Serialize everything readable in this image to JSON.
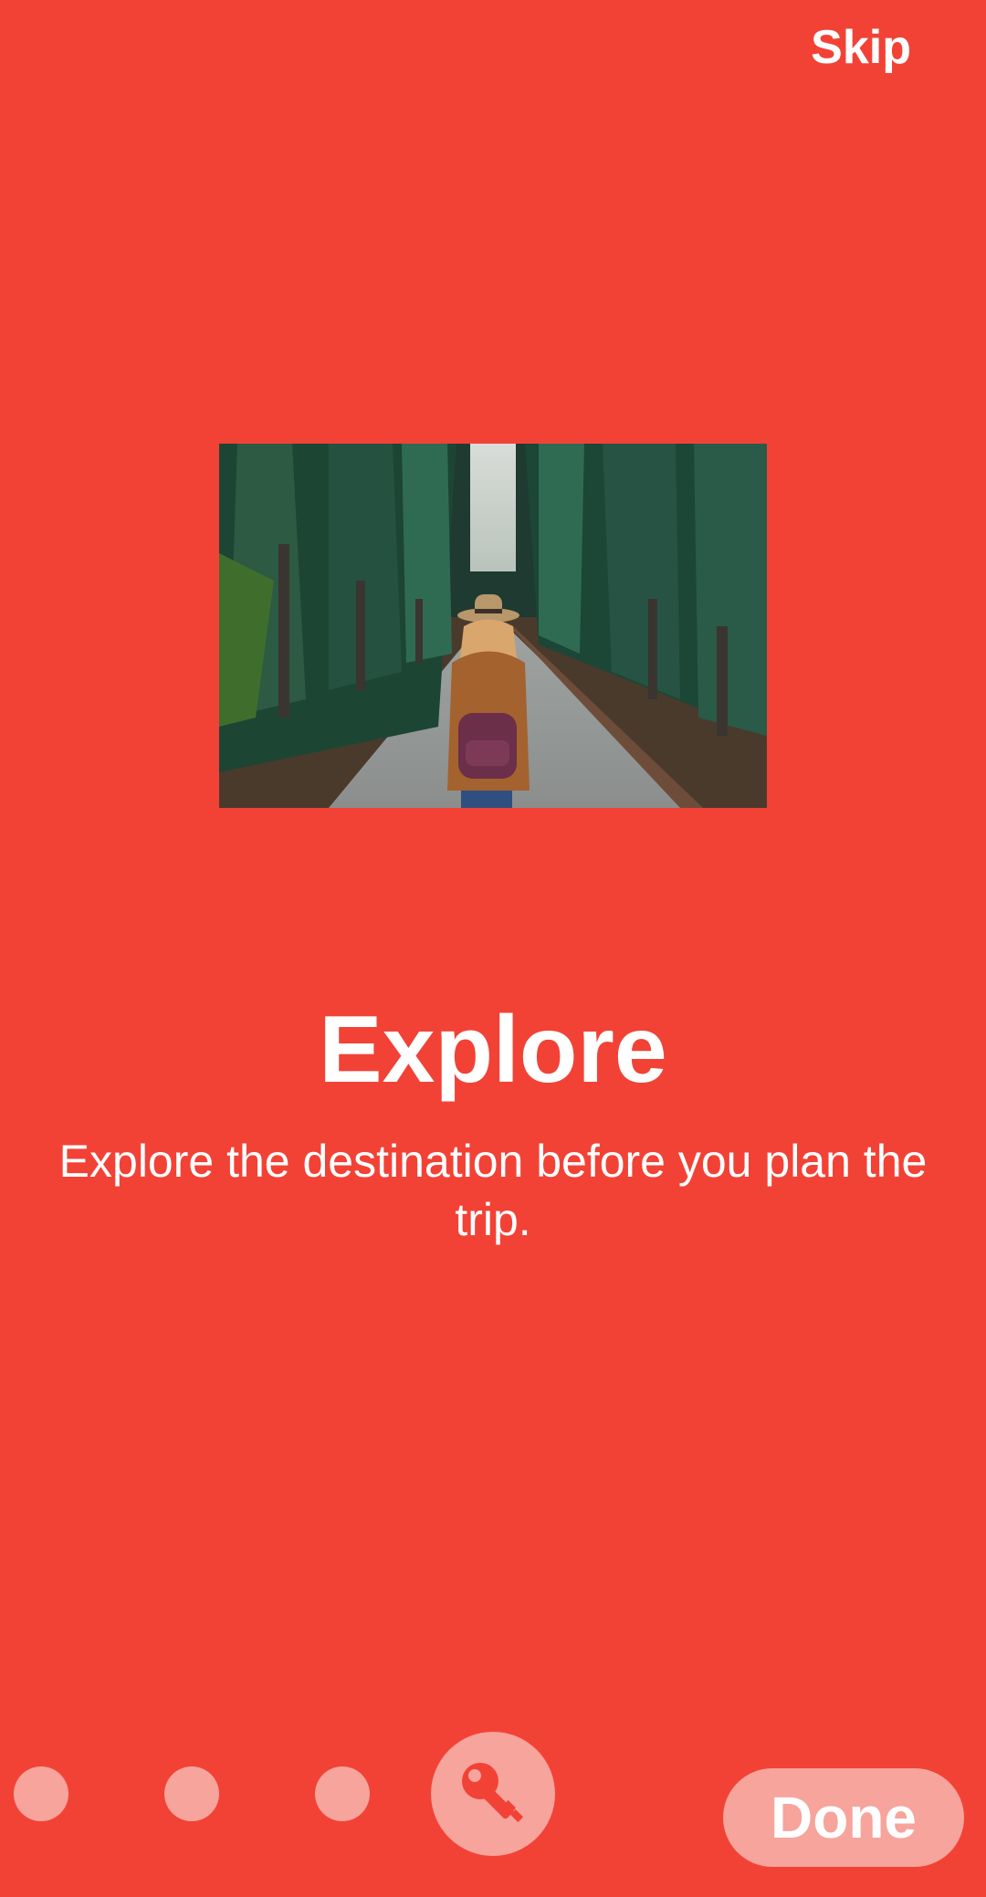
{
  "header": {
    "skip_label": "Skip"
  },
  "slide": {
    "title": "Explore",
    "description": "Explore the destination before you plan the trip."
  },
  "pager": {
    "total_pages": 4,
    "current_page": 4,
    "active_icon": "key-icon"
  },
  "footer": {
    "done_label": "Done"
  },
  "colors": {
    "background": "#F24236",
    "indicator": "#F6A49C",
    "text": "#FFFFFF"
  }
}
